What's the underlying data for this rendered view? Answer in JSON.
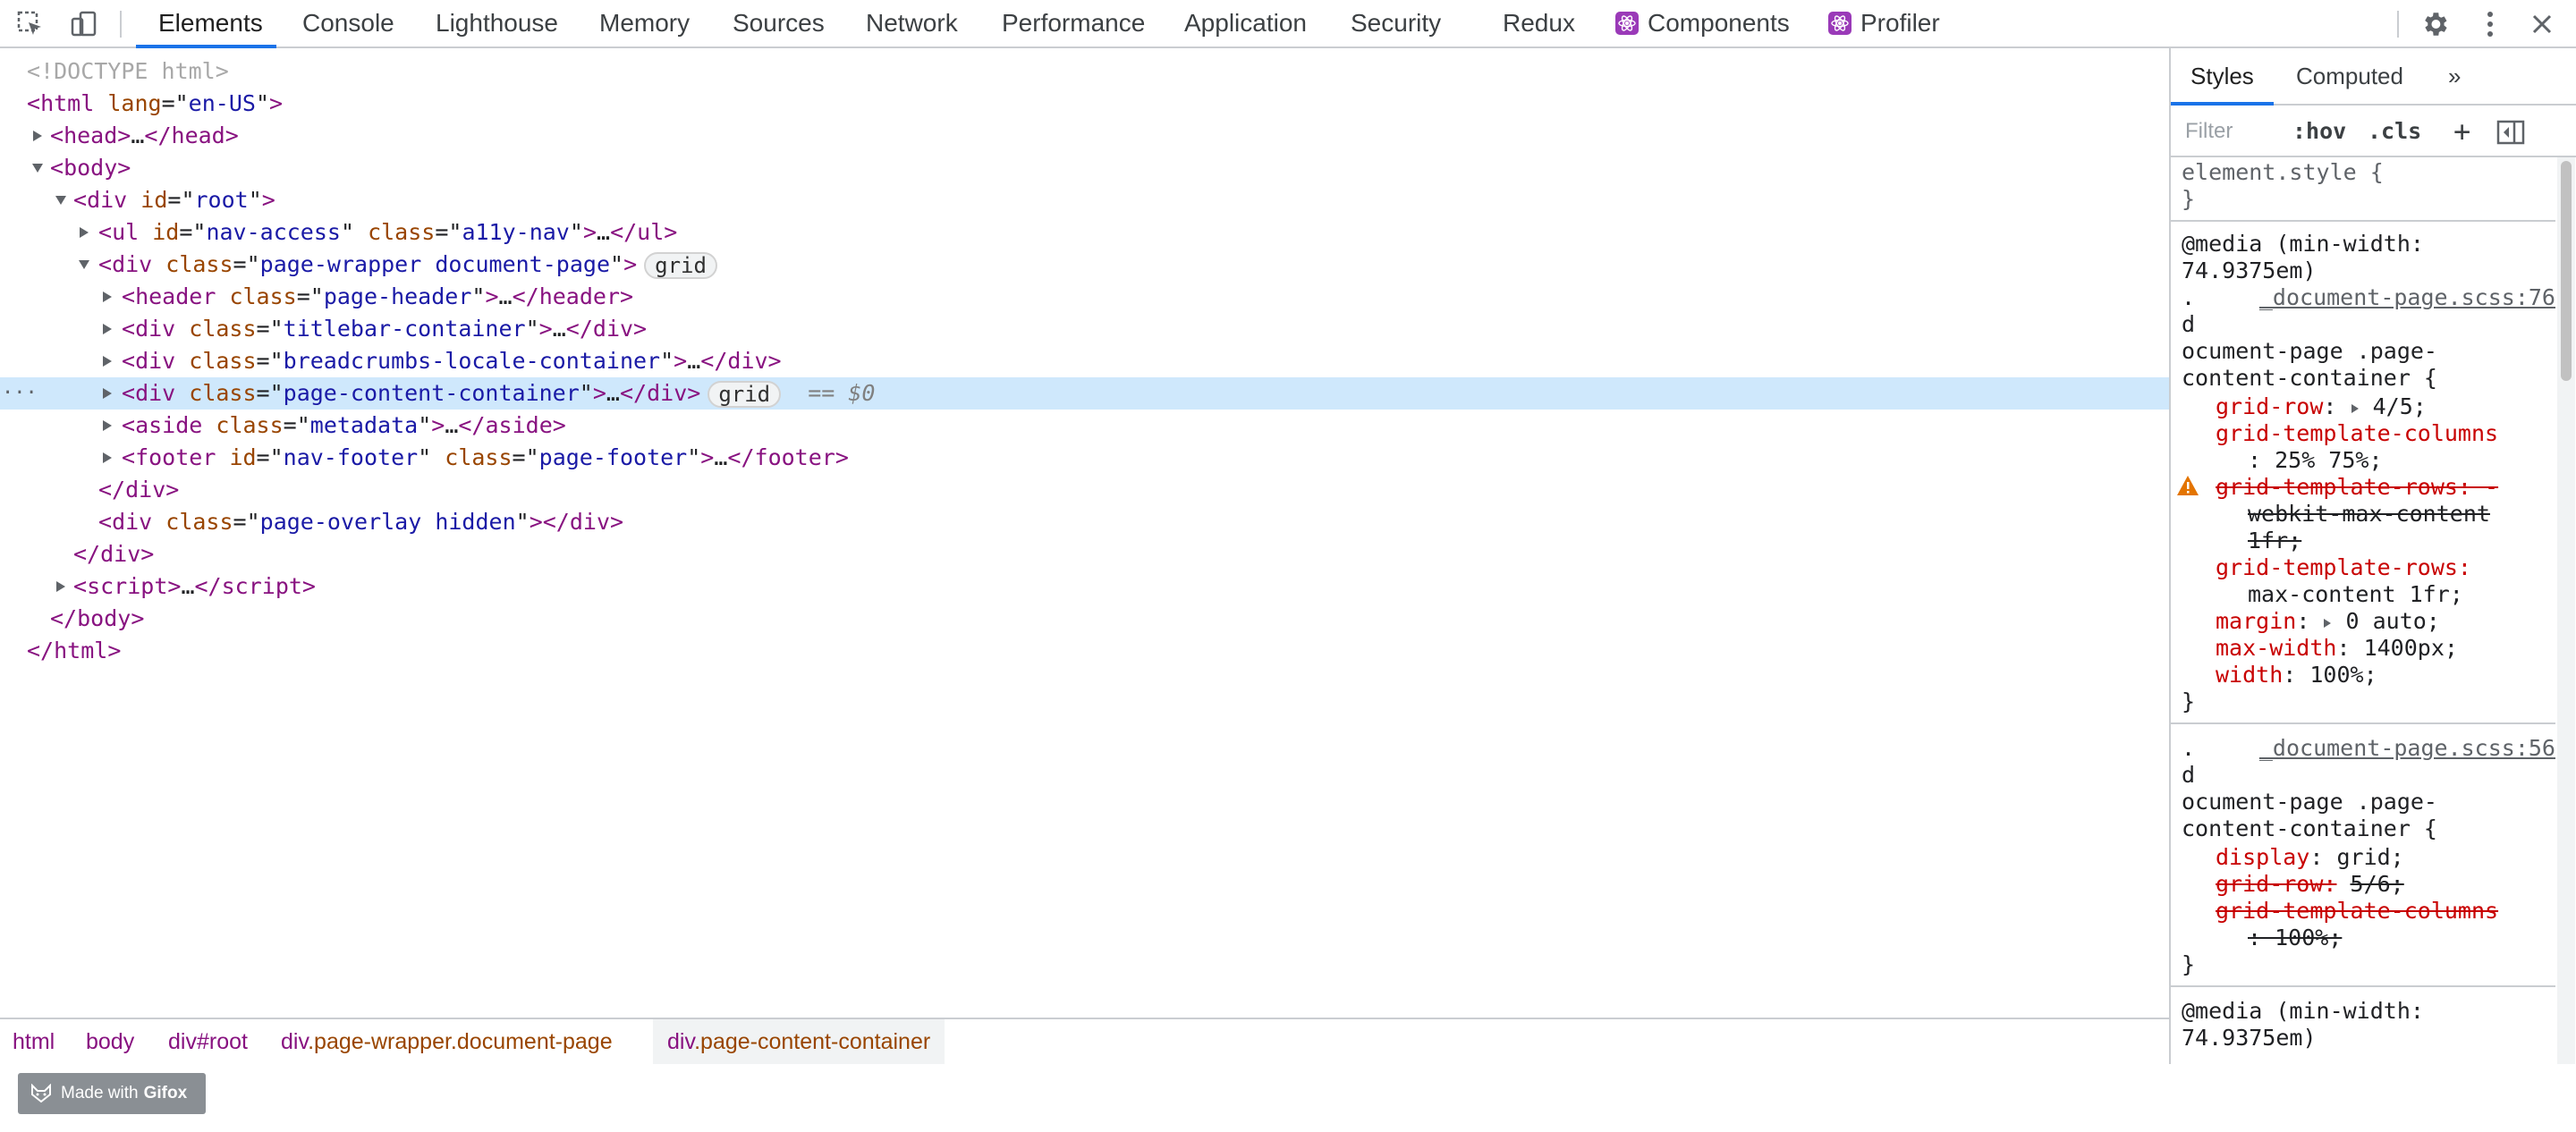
{
  "toolbar": {
    "tabs": [
      {
        "label": "Elements"
      },
      {
        "label": "Console"
      },
      {
        "label": "Lighthouse"
      },
      {
        "label": "Memory"
      },
      {
        "label": "Sources"
      },
      {
        "label": "Network"
      },
      {
        "label": "Performance"
      },
      {
        "label": "Application"
      },
      {
        "label": "Security"
      },
      {
        "label": "Redux"
      },
      {
        "label": "Components"
      },
      {
        "label": "Profiler"
      }
    ]
  },
  "dom": {
    "doctype": "<!DOCTYPE html>",
    "html_open": "html",
    "lang_attr": "lang",
    "lang_val": "en-US",
    "head": "head",
    "body": "body",
    "div": "div",
    "id_attr": "id",
    "class_attr": "class",
    "root_val": "root",
    "ul": "ul",
    "nav_access_val": "nav-access",
    "a11y_val": "a11y-nav",
    "page_wrapper_val": "page-wrapper document-page",
    "grid_badge": "grid",
    "header": "header",
    "page_header_val": "page-header",
    "titlebar_val": "titlebar-container",
    "breadcrumbs_val": "breadcrumbs-locale-container",
    "content_val": "page-content-container",
    "selected_marker": "== $0",
    "aside": "aside",
    "metadata_val": "metadata",
    "footer": "footer",
    "nav_footer_val": "nav-footer",
    "page_footer_val": "page-footer",
    "overlay_val": "page-overlay hidden",
    "script": "script",
    "ellipsis": "…",
    "more_dots": "···"
  },
  "breadcrumbs": [
    {
      "tag": "html",
      "rest": ""
    },
    {
      "tag": "body",
      "rest": ""
    },
    {
      "tag": "div",
      "rest": "#root"
    },
    {
      "tag": "div",
      "rest": ".page-wrapper.document-page"
    },
    {
      "tag": "div",
      "rest": ".page-content-container"
    }
  ],
  "styles": {
    "tabs": [
      "Styles",
      "Computed",
      "»"
    ],
    "filter_placeholder": "Filter",
    "hov": ":hov",
    "cls": ".cls",
    "plus": "+",
    "element_style": "element.style {",
    "close_brace": "}",
    "media_1a": "@media (min-width:",
    "media_1b": "74.9375em)",
    "source_1": "_document-page.scss:76",
    "source_2": "_document-page.scss:56",
    "sel_dot": ".",
    "sel_d": "d",
    "sel_a": "ocument-page .page-",
    "sel_b": "content-container {",
    "p_grid_row": "grid-row",
    "v_grid_row": "4/5;",
    "p_gtc": "grid-template-columns",
    "v_gtc": ": 25% 75%;",
    "p_gtr_bad": "grid-template-rows: -",
    "v_gtr_bad1": "webkit-max-content",
    "v_gtr_bad2": "1fr;",
    "p_gtr": "grid-template-rows:",
    "v_gtr": "max-content 1fr;",
    "p_margin": "margin",
    "v_margin": "0 auto;",
    "p_maxw": "max-width",
    "v_maxw": "1400px;",
    "p_width": "width",
    "v_width": "100%;",
    "p_display": "display",
    "v_display": "grid;",
    "p_grid_row_2": "grid-row:",
    "v_grid_row_2": "5/6;",
    "p_gtc_2": "grid-template-columns",
    "v_gtc_2": ": 100%;",
    "media_2a": "@media (min-width:",
    "media_2b": "74.9375em)"
  },
  "gifox": {
    "made_with": "Made with",
    "brand": "Gifox"
  },
  "colors": {
    "accent": "#1a73e8",
    "tag": "#881280",
    "attr": "#994500",
    "value": "#1a1aa6",
    "selected_row": "#cfe8fc",
    "css_property": "#c80000"
  }
}
